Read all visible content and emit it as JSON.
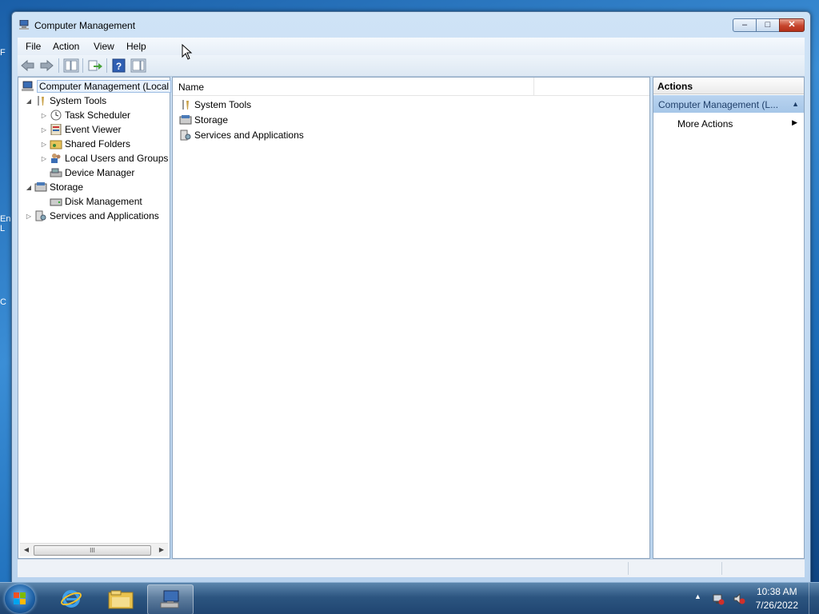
{
  "window": {
    "title": "Computer Management"
  },
  "caption_buttons": {
    "minimize": "–",
    "maximize": "□",
    "close": "✕"
  },
  "menu": {
    "file": "File",
    "action": "Action",
    "view": "View",
    "help": "Help"
  },
  "toolbar": {
    "back_icon": "back-arrow",
    "forward_icon": "forward-arrow",
    "show_hide_tree_icon": "console-tree",
    "export_icon": "export-list",
    "help_icon": "help",
    "show_hide_action_icon": "action-pane"
  },
  "tree": {
    "root": "Computer Management (Local",
    "system_tools": "System Tools",
    "task_scheduler": "Task Scheduler",
    "event_viewer": "Event Viewer",
    "shared_folders": "Shared Folders",
    "local_users": "Local Users and Groups",
    "device_manager": "Device Manager",
    "storage": "Storage",
    "disk_management": "Disk Management",
    "services_apps": "Services and Applications",
    "scroll_grip": "III"
  },
  "list": {
    "column_name": "Name",
    "items": [
      "System Tools",
      "Storage",
      "Services and Applications"
    ]
  },
  "actions": {
    "header": "Actions",
    "section": "Computer Management (L...",
    "more_actions": "More Actions"
  },
  "taskbar": {
    "time": "10:38 AM",
    "date": "7/26/2022"
  },
  "colors": {
    "desktop": "#1c6cb8",
    "selection": "#e8f1fc",
    "action_section": "#b9d4f0"
  }
}
